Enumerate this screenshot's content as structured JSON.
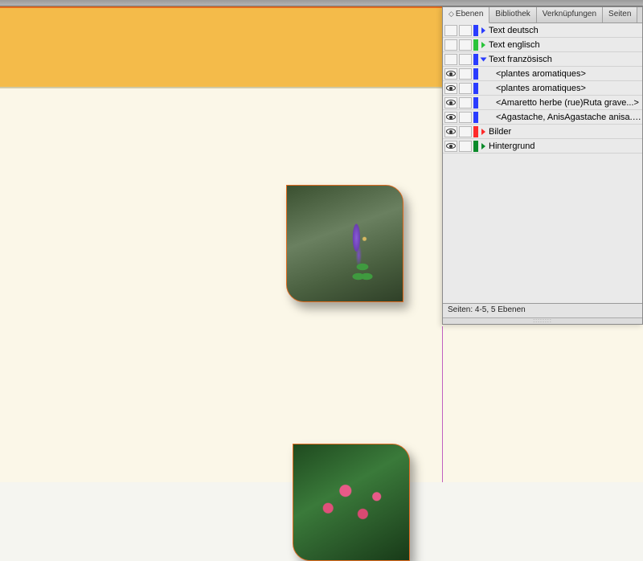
{
  "panel": {
    "tabs": [
      {
        "label": "Ebenen",
        "active": true,
        "sortable": true
      },
      {
        "label": "Bibliothek",
        "active": false
      },
      {
        "label": "Verknüpfungen",
        "active": false
      },
      {
        "label": "Seiten",
        "active": false
      }
    ],
    "status": "Seiten: 4-5, 5 Ebenen",
    "layers": [
      {
        "name": "Text deutsch",
        "color": "#2a3cff",
        "tri": "#2a3cff",
        "visible": false,
        "expanded": false,
        "indent": 0
      },
      {
        "name": "Text englisch",
        "color": "#29c43a",
        "tri": "#29c43a",
        "visible": false,
        "expanded": false,
        "indent": 0
      },
      {
        "name": "Text französisch",
        "color": "#2a3cff",
        "tri": "#2a3cff",
        "visible": false,
        "expanded": true,
        "indent": 0
      },
      {
        "name": "<plantes aromatiques>",
        "color": "#2a3cff",
        "visible": true,
        "indent": 1
      },
      {
        "name": "<plantes aromatiques>",
        "color": "#2a3cff",
        "visible": true,
        "indent": 1
      },
      {
        "name": "<Amaretto herbe (rue)Ruta grave...>",
        "color": "#2a3cff",
        "visible": true,
        "indent": 1
      },
      {
        "name": "<Agastache, AnisAgastache anisa...>",
        "color": "#2a3cff",
        "visible": true,
        "indent": 1
      },
      {
        "name": "Bilder",
        "color": "#ff2a2a",
        "tri": "#ff2a2a",
        "visible": true,
        "expanded": false,
        "indent": 0
      },
      {
        "name": "Hintergrund",
        "color": "#0a8a2a",
        "tri": "#0a8a2a",
        "visible": true,
        "expanded": false,
        "indent": 0
      }
    ]
  },
  "canvas": {
    "frames": [
      {
        "id": "frame1",
        "kind": "purple"
      },
      {
        "id": "frame2",
        "kind": "pink"
      }
    ]
  }
}
